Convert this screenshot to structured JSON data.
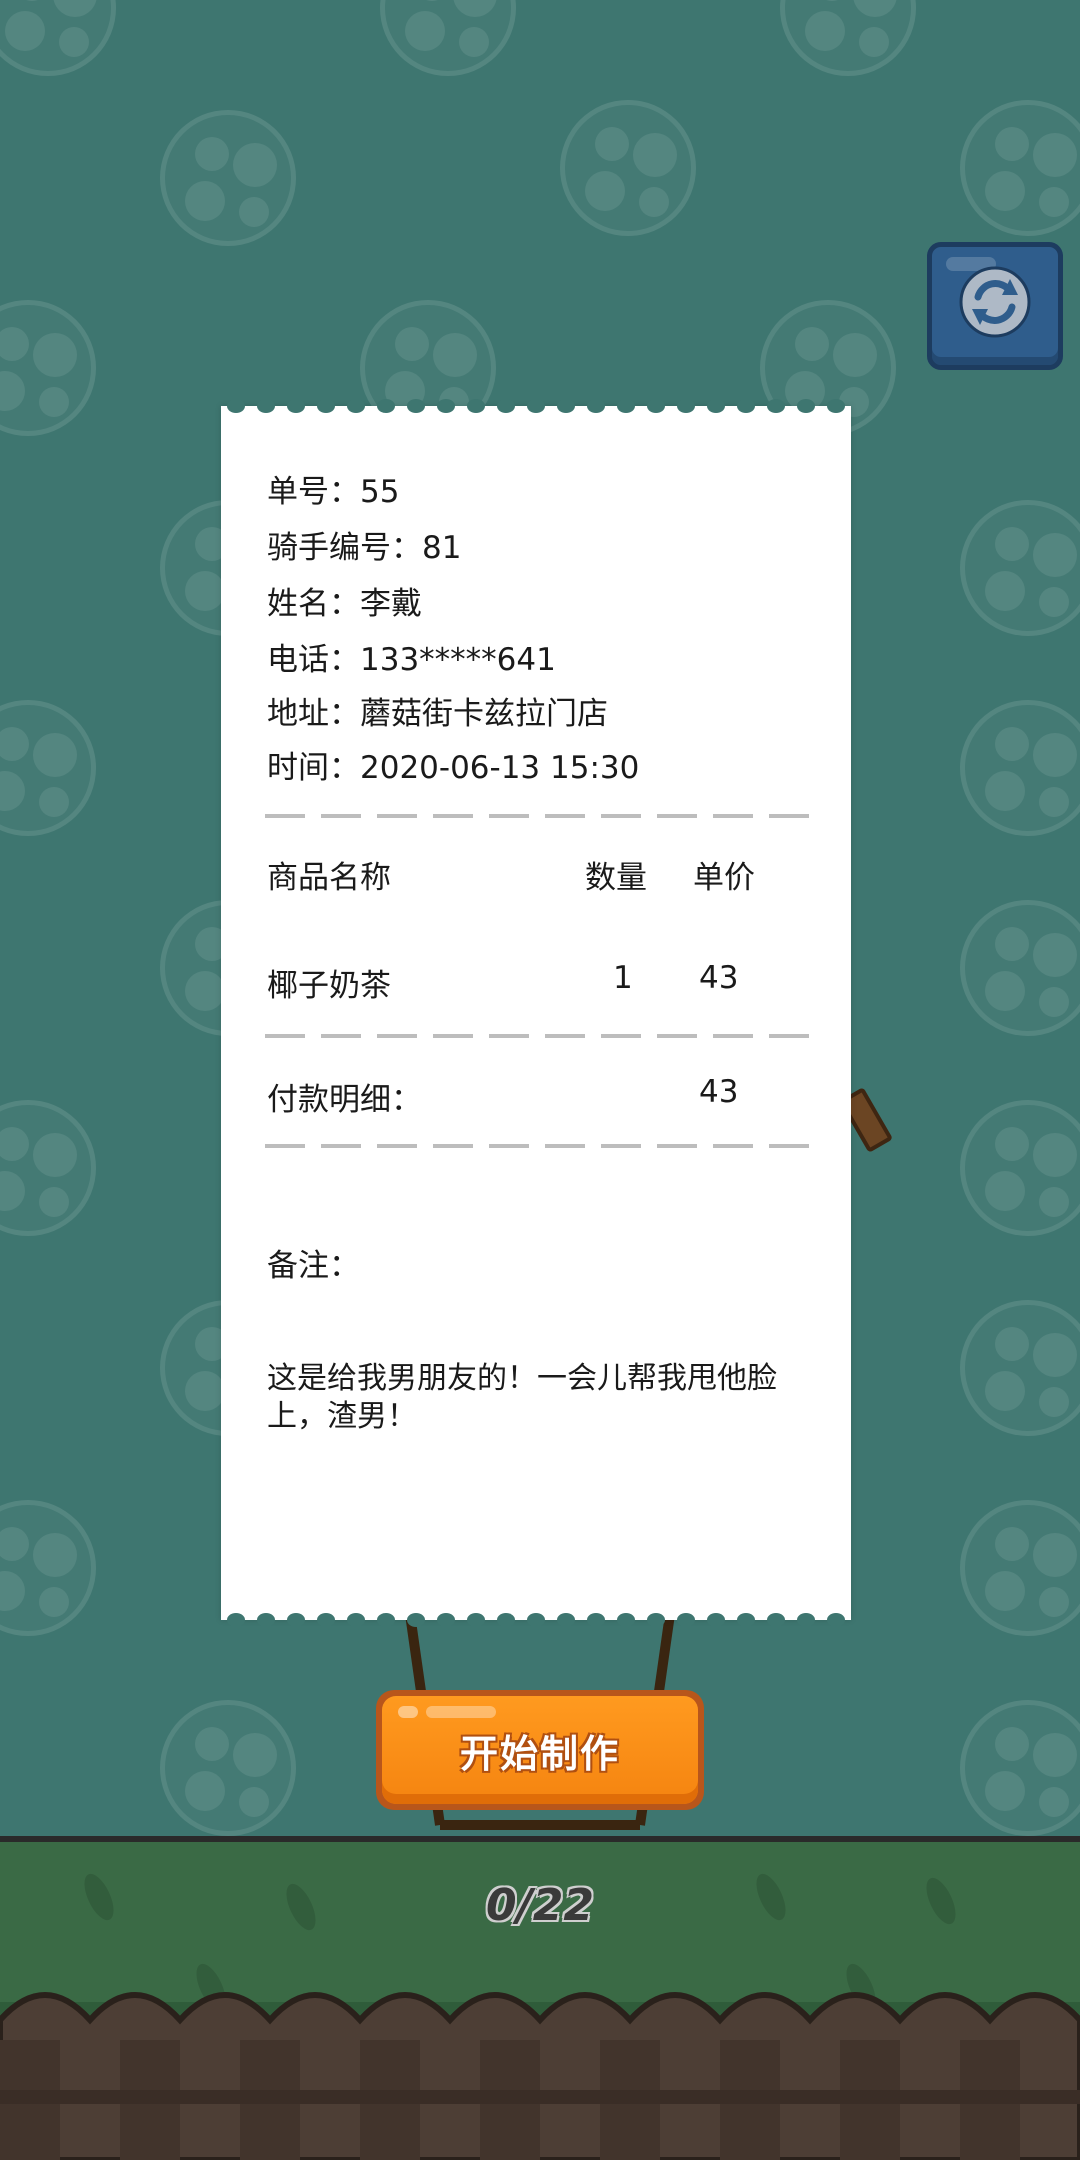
{
  "receipt": {
    "order_no": "单号：55",
    "rider_no": "骑手编号：81",
    "name": "姓名：李戴",
    "phone": "电话：133*****641",
    "address": "地址：蘑菇街卡兹拉门店",
    "time": "时间：2020-06-13 15:30",
    "columns": {
      "product": "商品名称",
      "quantity": "数量",
      "unit_price": "单价"
    },
    "items": [
      {
        "name": "椰子奶茶",
        "quantity": "1",
        "price": "43"
      }
    ],
    "payment_label": "付款明细：",
    "payment_total": "43",
    "remark_label": "备注：",
    "remark_text": "这是给我男朋友的！一会儿帮我甩他脸上，渣男！"
  },
  "start_button_label": "开始制作",
  "progress": "0/22",
  "icons": {
    "refresh": "refresh-icon"
  },
  "colors": {
    "background": "#3e7670",
    "start_button": "#f58410",
    "refresh_button": "#2f5d8c"
  }
}
